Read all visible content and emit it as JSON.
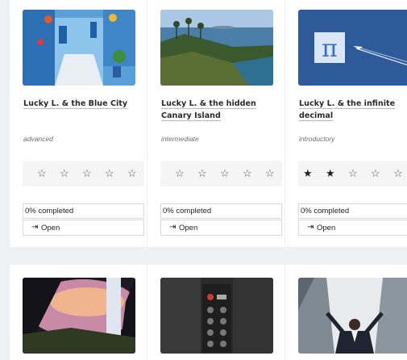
{
  "courses": [
    {
      "title": "Lucky L. & the Blue City",
      "level": "advanced",
      "rating": 0,
      "progress": 0,
      "progress_label": "0% completed",
      "open_label": "Open",
      "image": "blue-city-image"
    },
    {
      "title": "Lucky L. & the hidden Canary Island",
      "level": "intermediate",
      "rating": 0,
      "progress": 0,
      "progress_label": "0% completed",
      "open_label": "Open",
      "image": "canary-island-image"
    },
    {
      "title": "Lucky L. & the infinite decimal",
      "level": "introductory",
      "rating": 2,
      "progress": 0,
      "progress_label": "0% completed",
      "open_label": "Open",
      "image": "pi-airplane-image"
    },
    {
      "image": "waterfall-image"
    },
    {
      "image": "elevator-panel-image"
    },
    {
      "image": "businessman-skyscrapers-image"
    }
  ],
  "rating_max": 5,
  "icons": {
    "star_empty": "☆",
    "star_filled": "★",
    "open": "⇥",
    "pi": "π"
  }
}
